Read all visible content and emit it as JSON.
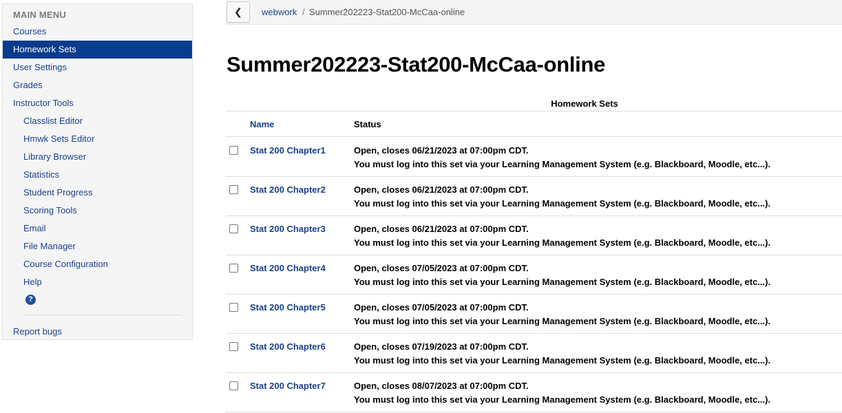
{
  "sidebar": {
    "header": "MAIN MENU",
    "items": [
      {
        "label": "Courses"
      },
      {
        "label": "Homework Sets"
      },
      {
        "label": "User Settings"
      },
      {
        "label": "Grades"
      },
      {
        "label": "Instructor Tools"
      },
      {
        "label": "Classlist Editor"
      },
      {
        "label": "Hmwk Sets Editor"
      },
      {
        "label": "Library Browser"
      },
      {
        "label": "Statistics"
      },
      {
        "label": "Student Progress"
      },
      {
        "label": "Scoring Tools"
      },
      {
        "label": "Email"
      },
      {
        "label": "File Manager"
      },
      {
        "label": "Course Configuration"
      },
      {
        "label": "Help"
      }
    ],
    "help_icon": "question-circle-icon",
    "report_bugs": "Report bugs",
    "active_color": "#083c8c",
    "link_color": "#1a3f8a"
  },
  "breadcrumb": {
    "back_icon": "chevron-left-icon",
    "root": "webwork",
    "separator": "/",
    "current": "Summer202223-Stat200-McCaa-online"
  },
  "page": {
    "title": "Summer202223-Stat200-McCaa-online"
  },
  "table": {
    "caption": "Homework Sets",
    "columns": {
      "name": "Name",
      "status": "Status"
    },
    "rows": [
      {
        "name": "Stat 200 Chapter1",
        "status": "Open, closes 06/21/2023 at 07:00pm CDT.",
        "note": "You must log into this set via your Learning Management System (e.g. Blackboard, Moodle, etc...)."
      },
      {
        "name": "Stat 200 Chapter2",
        "status": "Open, closes 06/21/2023 at 07:00pm CDT.",
        "note": "You must log into this set via your Learning Management System (e.g. Blackboard, Moodle, etc...)."
      },
      {
        "name": "Stat 200 Chapter3",
        "status": "Open, closes 06/21/2023 at 07:00pm CDT.",
        "note": "You must log into this set via your Learning Management System (e.g. Blackboard, Moodle, etc...)."
      },
      {
        "name": "Stat 200 Chapter4",
        "status": "Open, closes 07/05/2023 at 07:00pm CDT.",
        "note": "You must log into this set via your Learning Management System (e.g. Blackboard, Moodle, etc...)."
      },
      {
        "name": "Stat 200 Chapter5",
        "status": "Open, closes 07/05/2023 at 07:00pm CDT.",
        "note": "You must log into this set via your Learning Management System (e.g. Blackboard, Moodle, etc...)."
      },
      {
        "name": "Stat 200 Chapter6",
        "status": "Open, closes 07/19/2023 at 07:00pm CDT.",
        "note": "You must log into this set via your Learning Management System (e.g. Blackboard, Moodle, etc...)."
      },
      {
        "name": "Stat 200 Chapter7",
        "status": "Open, closes 08/07/2023 at 07:00pm CDT.",
        "note": "You must log into this set via your Learning Management System (e.g. Blackboard, Moodle, etc...)."
      }
    ]
  }
}
